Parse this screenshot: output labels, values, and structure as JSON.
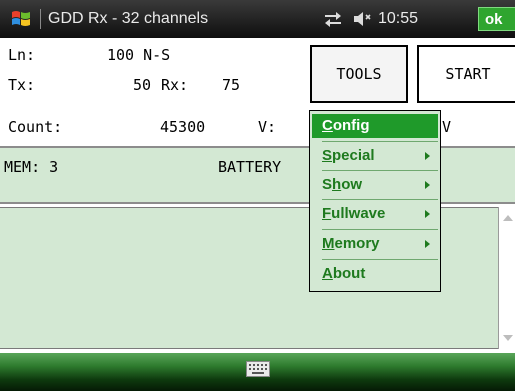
{
  "titlebar": {
    "app_title": "GDD Rx - 32 channels",
    "clock": "10:55",
    "ok_label": "ok",
    "icons": [
      "windows-start-icon",
      "connectivity-icon",
      "volume-icon"
    ]
  },
  "info": {
    "ln_label": "Ln:",
    "ln_value": "100 N-S",
    "tx_label": "Tx:",
    "tx_value": "50",
    "rx_label": "Rx:",
    "rx_value": "75",
    "count_label": "Count:",
    "count_value": "45300",
    "v_label": "V:",
    "v_unit": "V"
  },
  "buttons": {
    "tools": "TOOLS",
    "start": "START"
  },
  "status": {
    "mem": "MEM: 3",
    "battery": "BATTERY"
  },
  "menu": {
    "items": [
      {
        "pre": "",
        "u": "C",
        "post": "onfig",
        "submenu": false
      },
      {
        "pre": "",
        "u": "S",
        "post": "pecial",
        "submenu": true
      },
      {
        "pre": "S",
        "u": "h",
        "post": "ow",
        "submenu": true
      },
      {
        "pre": "",
        "u": "F",
        "post": "ullwave",
        "submenu": true
      },
      {
        "pre": "",
        "u": "M",
        "post": "emory",
        "submenu": true
      },
      {
        "pre": "",
        "u": "A",
        "post": "bout",
        "submenu": false
      }
    ]
  },
  "colors": {
    "panel_green": "#d3e8d3",
    "menu_highlight": "#1f9a2a",
    "menu_text": "#1e7a1e",
    "ok_green": "#2fa52f"
  }
}
